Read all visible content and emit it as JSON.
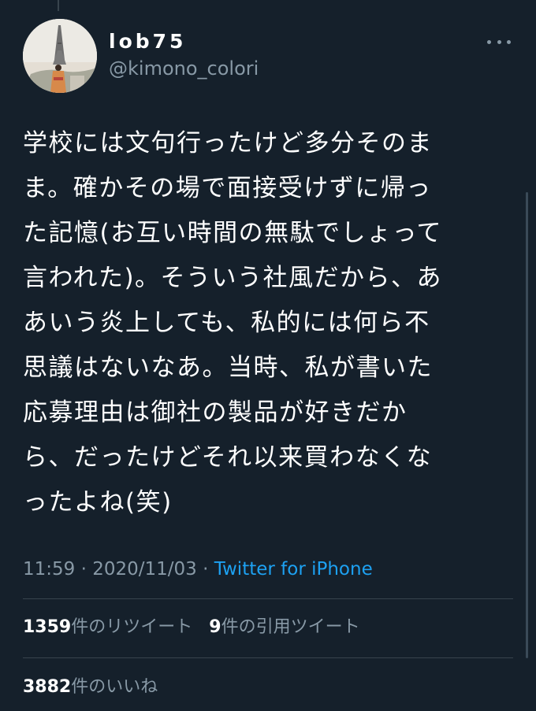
{
  "author": {
    "display_name": "lob75",
    "handle": "@kimono_colori"
  },
  "tweet": {
    "lines": [
      "学校には文句行ったけど多分そのま",
      "ま。確かその場で面接受けずに帰っ",
      "た記憶(お互い時間の無駄でしょって",
      "言われた)。そういう社風だから、あ",
      "あいう炎上しても、私的には何ら不",
      "思議はないなあ。当時、私が書いた",
      "応募理由は御社の製品が好きだか",
      "ら、だったけどそれ以来買わなくな",
      "ったよね(笑)"
    ]
  },
  "meta": {
    "time": "11:59",
    "separator1": " · ",
    "date": "2020/11/03",
    "separator2": " · ",
    "source": "Twitter for iPhone"
  },
  "stats": {
    "retweets_count": "1359",
    "retweets_label": "件のリツイート",
    "quotes_count": "9",
    "quotes_label": "件の引用ツイート",
    "likes_count": "3882",
    "likes_label": "件のいいね"
  },
  "colors": {
    "background": "#15202b",
    "text_primary": "#ffffff",
    "text_secondary": "#8899a6",
    "accent": "#1da1f2",
    "divider": "#38444d"
  },
  "icons": {
    "more": "more-horizontal-icon"
  }
}
